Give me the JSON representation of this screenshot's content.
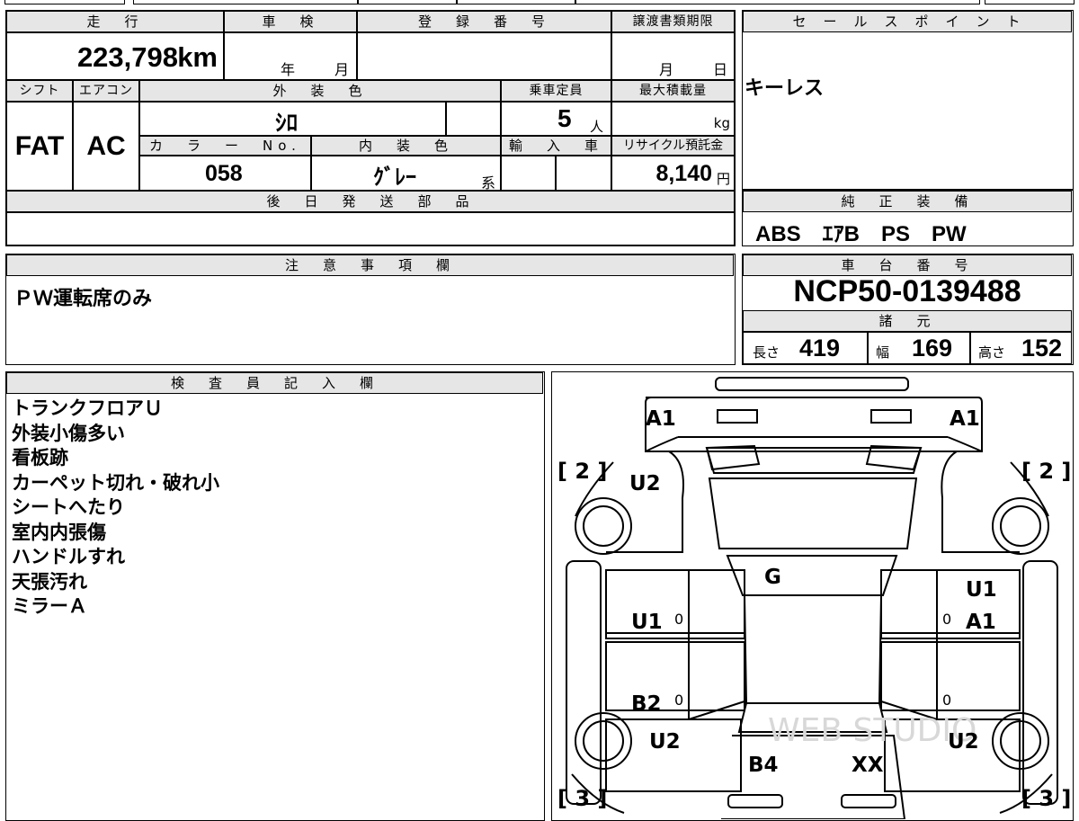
{
  "top": {
    "mileage_header": "走　行",
    "mileage_value": "223,798",
    "mileage_unit": "km",
    "inspection_header": "車　検",
    "inspection_year": "年",
    "inspection_month": "月",
    "registration_header": "登　録　番　号",
    "transfer_header": "譲渡書類期限",
    "transfer_month": "月",
    "transfer_day": "日",
    "shift_header": "シフト",
    "shift_value": "FAT",
    "ac_header": "エアコン",
    "ac_value": "AC",
    "exterior_color_header": "外　装　色",
    "exterior_color_value": "ｼﾛ",
    "capacity_header": "乗車定員",
    "capacity_value": "5",
    "capacity_unit": "人",
    "max_load_header": "最大積載量",
    "max_load_unit": "kg",
    "color_no_header": "カ　ラ　ー　No.",
    "color_no_value": "058",
    "interior_color_header": "内　装　色",
    "interior_color_value": "ｸﾞﾚｰ",
    "interior_color_suffix": "系",
    "import_header": "輸　入　車",
    "recycle_header": "リサイクル預託金",
    "recycle_value": "8,140",
    "recycle_unit": "円",
    "parts_header": "後　日　発　送　部　品"
  },
  "sales_point": {
    "header": "セ　ー　ル　ス　ポ　イ　ン　ト",
    "value": "キーレス"
  },
  "genuine_equipment": {
    "header": "純　正　装　備",
    "value": "ABS　ｴｱB　PS　PW"
  },
  "caution": {
    "header": "注　意　事　項　欄",
    "value": "ＰＷ運転席のみ"
  },
  "chassis": {
    "header": "車　台　番　号",
    "value": "NCP50-0139488"
  },
  "specs": {
    "header": "諸　元",
    "length_label": "長さ",
    "length_value": "419",
    "width_label": "幅",
    "width_value": "169",
    "height_label": "高さ",
    "height_value": "152"
  },
  "inspector": {
    "header": "検　査　員　記　入　欄",
    "lines": [
      "トランクフロアＵ",
      "外装小傷多い",
      "看板跡",
      "カーペット切れ・破れ小",
      "シートへたり",
      "室内内張傷",
      "ハンドルすれ",
      "天張汚れ",
      "ミラーＡ"
    ]
  },
  "diagram": {
    "marks": {
      "rear_left": "A1",
      "rear_right": "A1",
      "left_rear_quarter": "U2",
      "roof": "G",
      "left_rear_door": "U1",
      "left_front_door": "B2",
      "left_front_fender": "U2",
      "hood_left": "B4",
      "hood_right": "XX",
      "right_rear_door_1": "U1",
      "right_rear_door_2": "A1",
      "right_front_fender": "U2"
    },
    "tire_left_top": "[ 2 ]",
    "tire_right_top": "[ 2 ]",
    "tire_left_bottom": "[ 3 ]",
    "tire_right_bottom": "[ 3 ]",
    "small_zero": "0",
    "watermark": "WEB STUDIO"
  }
}
